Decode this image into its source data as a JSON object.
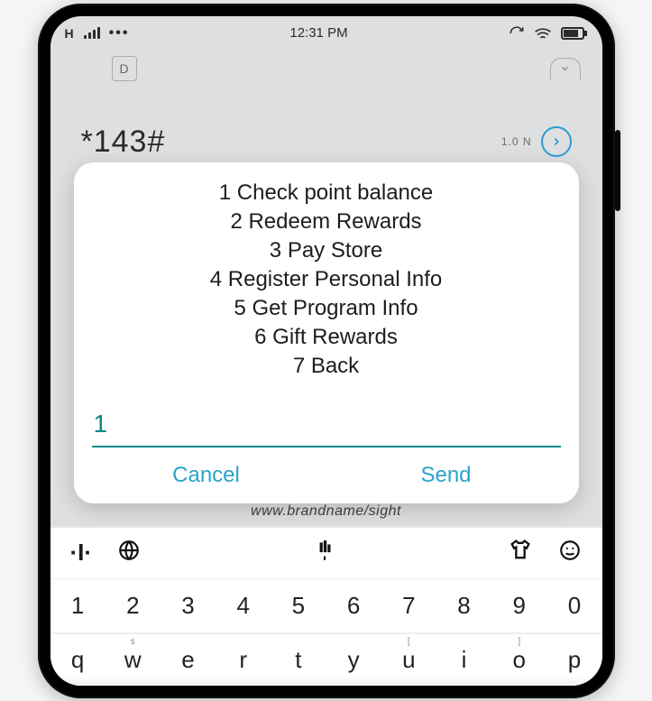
{
  "status": {
    "carrier": "H",
    "time": "12:31 PM",
    "more": "•••"
  },
  "subbar": {
    "tab_label": "D"
  },
  "dialed": {
    "code": "*143#",
    "meta": "1.0 N"
  },
  "dialog": {
    "menu": [
      "1 Check point balance",
      "2 Redeem Rewards",
      "3 Pay Store",
      "4 Register Personal Info",
      "5 Get Program Info",
      "6 Gift Rewards",
      "7 Back"
    ],
    "input_value": "1",
    "cancel": "Cancel",
    "send": "Send"
  },
  "background_hint": "www.brandname/sight",
  "keyboard": {
    "numbers": [
      "1",
      "2",
      "3",
      "4",
      "5",
      "6",
      "7",
      "8",
      "9",
      "0"
    ],
    "letters": [
      "q",
      "w",
      "e",
      "r",
      "t",
      "y",
      "u",
      "i",
      "o",
      "p"
    ],
    "hints": [
      "",
      "s",
      "",
      "",
      "",
      "",
      "[",
      "",
      "]",
      ""
    ]
  }
}
